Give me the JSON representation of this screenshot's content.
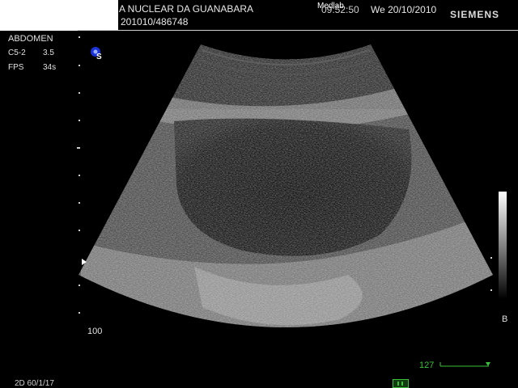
{
  "header": {
    "clinic_name": "A NUCLEAR DA GUANABARA",
    "patient_id": "201010/486748",
    "watermark": "Medlab",
    "time": "09:52:50",
    "date": "We 20/10/2010",
    "brand": "SIEMENS"
  },
  "left_panel": {
    "exam": "ABDOMEN",
    "probe": "C5-2",
    "probe_value": "3.5",
    "fps_label": "FPS",
    "fps_value": "34s"
  },
  "image": {
    "depth_label": "100",
    "label_b": "B",
    "scale_value": "127",
    "footer_text": "2D 60/1/17"
  },
  "icons": {
    "orientation": "orientation-marker-icon",
    "freeze": "freeze-icon",
    "cursor": "cursor-arrow-icon"
  },
  "colors": {
    "background": "#000000",
    "scale": "#39c239",
    "marker": "#1f3cff",
    "text": "#e0e0e0"
  }
}
